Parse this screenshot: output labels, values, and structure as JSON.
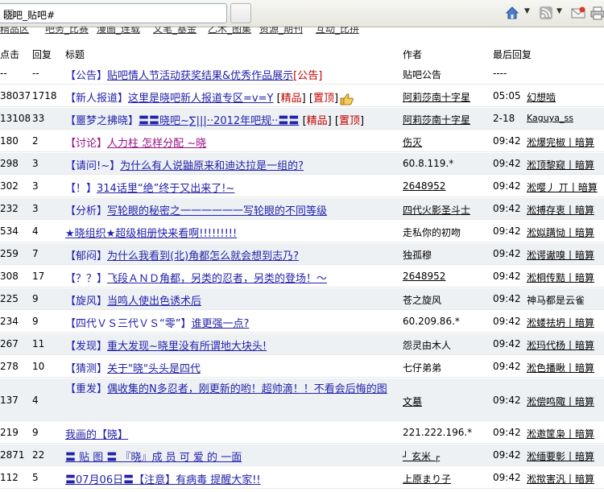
{
  "tab": {
    "title": "晓吧_贴吧#"
  },
  "nav_tags": [
    "精品区",
    "吧务_比赛",
    "漫画_连载",
    "文笔_基金",
    "乙木_图集",
    "资源_期刊",
    "互动_比拼"
  ],
  "columns": {
    "click": "点击",
    "reply": "回复",
    "title": "标题",
    "author": "作者",
    "last": "最后回复"
  },
  "threads": [
    {
      "click": "--",
      "reply": "--",
      "tag": "【公告】",
      "text": "贴吧情人节活动获奖结果&优秀作品展示",
      "suffix": "[公告]",
      "author": "贴吧公告",
      "time": "",
      "last": "----"
    },
    {
      "click": "38037",
      "reply": "1718",
      "tag": "【新人报道】",
      "text": "这里是晓吧新人报道专区=v=Y",
      "jing": "精品",
      "ding": "置顶",
      "author": "阿莉莎南十字星",
      "time": "05:05",
      "last": "幻想啮"
    },
    {
      "click": "13108",
      "reply": "33",
      "tag": "【噩梦之拂晓】",
      "text": "〓〓晓吧~∑|||··2012年吧规··〓〓",
      "jing": "精品",
      "ding": "置顶",
      "author": "阿莉莎南十字星",
      "time": "2-18",
      "last": "Kaguya_ss"
    },
    {
      "click": "180",
      "reply": "2",
      "tag": "【讨论】",
      "text": "人力柱 怎样分配 ~晓",
      "author": "伤灭",
      "time": "09:42",
      "last": "淞爆完椒丨暗算"
    },
    {
      "click": "298",
      "reply": "3",
      "tag": "【请问!~】",
      "text": "为什么有人说鼬原来和迪达拉是一组的?",
      "author": "60.8.119.*",
      "time": "09:42",
      "last": "淞顶黎窥丨暗算"
    },
    {
      "click": "302",
      "reply": "3",
      "tag": "【！】",
      "text": "314话里“绝”终于又出来了!~",
      "author": "2648952",
      "time": "09:42",
      "last": "淞嘤丿 丌丨暗算"
    },
    {
      "click": "232",
      "reply": "3",
      "tag": "【分析】",
      "text": "写轮眼的秘密之一一一一一一写轮眼的不同等级",
      "author": "四代火影圣斗士",
      "time": "09:42",
      "last": "淞搏存衷丨暗算"
    },
    {
      "click": "534",
      "reply": "4",
      "tag": "",
      "text": "★晓组织★超级相册快来看啊!!!!!!!!!",
      "author": "走私你的初吻",
      "time": "09:42",
      "last": "淞姒蹒恸丨暗算"
    },
    {
      "click": "259",
      "reply": "7",
      "tag": "【郁闷】",
      "text": "为什么我看到(北)角都怎么就会想到志乃?",
      "author": "独孤穆",
      "time": "09:42",
      "last": "淞谔谳嗅丨暗算"
    },
    {
      "click": "308",
      "reply": "17",
      "tag": "【？？】",
      "text": "飞段ＡＮＤ角都，另类的忍者，另类的登场！～",
      "author": "2648952",
      "time": "09:42",
      "last": "淞桐传黠丨暗算"
    },
    {
      "click": "225",
      "reply": "9",
      "tag": "【旋风】",
      "text": "当鸣人使出色诱术后",
      "author": "苍之旋风",
      "time": "09:42",
      "last": "神马都是云雀"
    },
    {
      "click": "234",
      "reply": "9",
      "tag": "【四代ＶＳ三代ＶＳ“零”】",
      "text": "谁更强一点?",
      "author": "60.209.86.*",
      "time": "09:42",
      "last": "淞蝼祛坍丨暗算"
    },
    {
      "click": "267",
      "reply": "11",
      "tag": "【发现】",
      "text": "重大发现~晓里没有所谓地大块头!",
      "author": "怨灵由木人",
      "time": "09:42",
      "last": "淞玛代杨丨暗算"
    },
    {
      "click": "278",
      "reply": "10",
      "tag": "【猜测】",
      "text": "关于\"晓\"头头是四代",
      "author": "七仔弟弟",
      "time": "09:42",
      "last": "淞色播瞅丨暗算"
    },
    {
      "click": "137",
      "reply": "4",
      "tag": "【重发】",
      "text": "偶收集的N多忍者，刚更新的哟！超帅滴！！不看会后悔的图",
      "author": "文墓",
      "time": "09:42",
      "last": "淞偿鸣陬丨暗算"
    },
    {
      "click": "219",
      "reply": "9",
      "tag": "",
      "text": "我画的【晓】",
      "author": "221.222.196.*",
      "time": "09:42",
      "last": "淞邀筐枭丨暗算"
    },
    {
      "click": "2871",
      "reply": "22",
      "tag": "",
      "text": "〓 贴 图 〓 『晓』成 员 可 爱 的 一面",
      "author": "┘ 玄米 ┌",
      "time": "09:42",
      "last": "淞缅要彰丨暗算"
    },
    {
      "click": "112",
      "reply": "5",
      "tag": "",
      "text": "〓07月06日〓【注意】有病毒 提醒大家!!",
      "author": "上原まり子",
      "time": "09:42",
      "last": "淞揿害汎丨暗算"
    }
  ]
}
